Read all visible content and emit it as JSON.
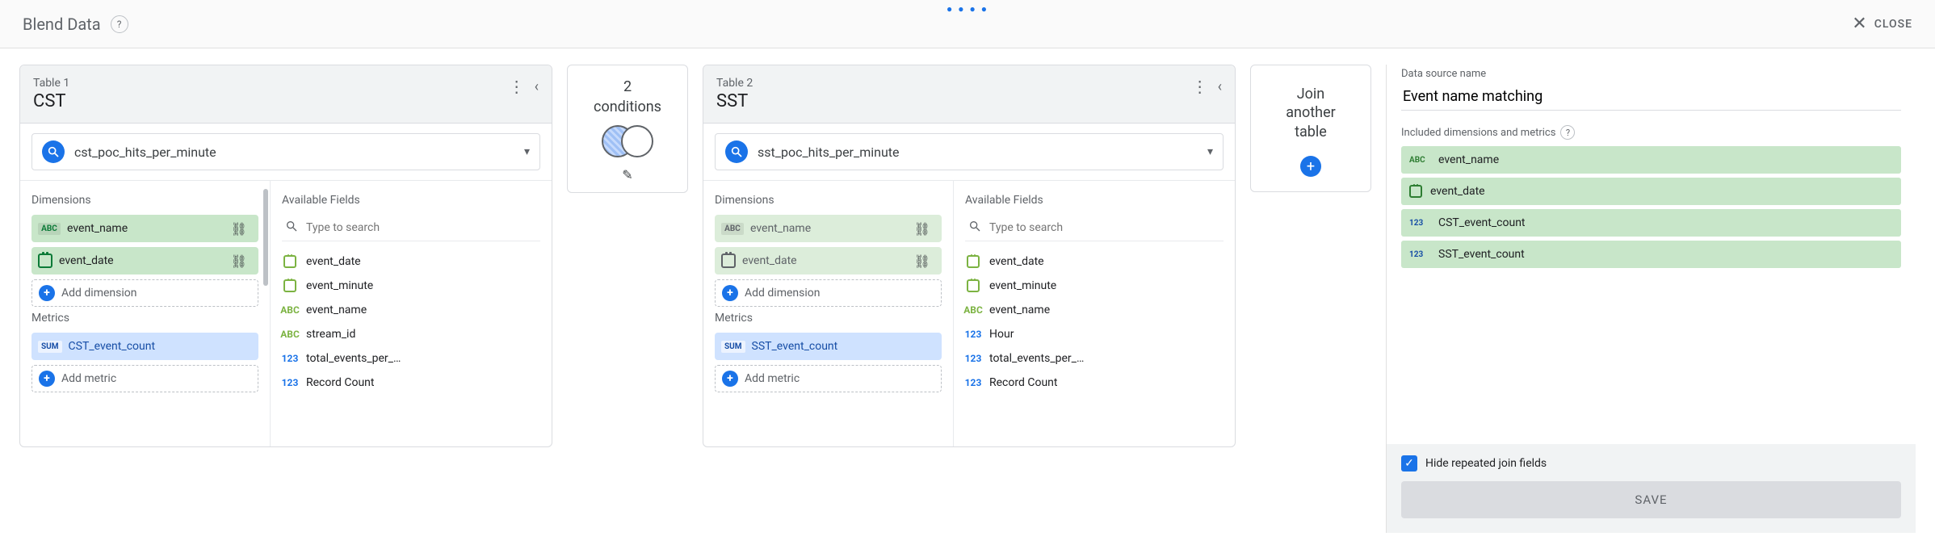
{
  "header": {
    "title": "Blend Data",
    "close_label": "CLOSE"
  },
  "table1": {
    "label": "Table 1",
    "name": "CST",
    "source": "cst_poc_hits_per_minute",
    "dimensions_label": "Dimensions",
    "metrics_label": "Metrics",
    "available_label": "Available Fields",
    "search_placeholder": "Type to search",
    "add_dim_label": "Add dimension",
    "add_met_label": "Add metric",
    "dim0": "event_name",
    "dim1": "event_date",
    "metric0": "CST_event_count",
    "avail": {
      "a0": "event_date",
      "a1": "event_minute",
      "a2": "event_name",
      "a3": "stream_id",
      "a4": "total_events_per_…",
      "a5": "Record Count"
    }
  },
  "join": {
    "count": "2",
    "label": "conditions"
  },
  "table2": {
    "label": "Table 2",
    "name": "SST",
    "source": "sst_poc_hits_per_minute",
    "dimensions_label": "Dimensions",
    "metrics_label": "Metrics",
    "available_label": "Available Fields",
    "search_placeholder": "Type to search",
    "add_dim_label": "Add dimension",
    "add_met_label": "Add metric",
    "dim0": "event_name",
    "dim1": "event_date",
    "metric0": "SST_event_count",
    "avail": {
      "a0": "event_date",
      "a1": "event_minute",
      "a2": "event_name",
      "a3": "Hour",
      "a4": "total_events_per_…",
      "a5": "Record Count"
    }
  },
  "join_another": {
    "line1": "Join",
    "line2": "another",
    "line3": "table"
  },
  "right": {
    "dsn_label": "Data source name",
    "dsn_value": "Event name matching",
    "inc_label": "Included dimensions and metrics",
    "inc0": "event_name",
    "inc1": "event_date",
    "inc2": "CST_event_count",
    "inc3": "SST_event_count",
    "hide_label": "Hide repeated join fields",
    "save_label": "SAVE"
  }
}
